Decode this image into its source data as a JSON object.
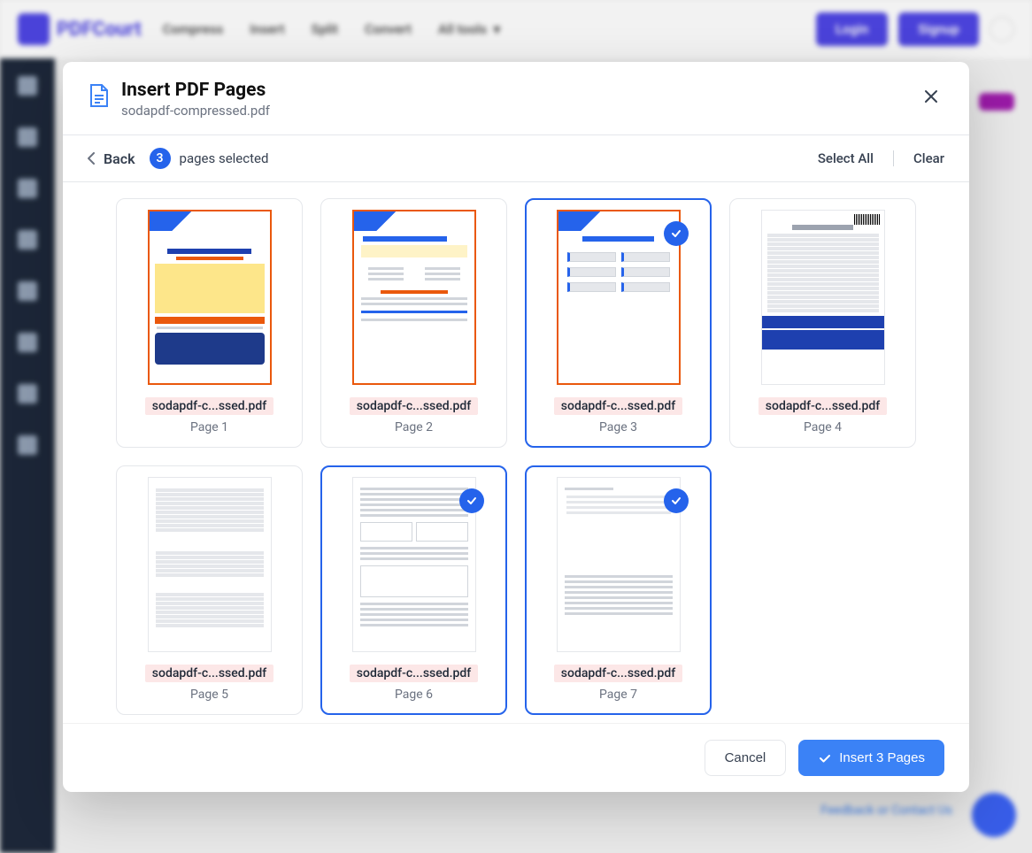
{
  "background": {
    "logo_text": "PDFCourt",
    "nav": [
      "Compress",
      "Insert",
      "Split",
      "Convert",
      "All tools"
    ],
    "login": "Login",
    "signup": "Signup",
    "feedback": "Feedback or Contact Us"
  },
  "modal": {
    "title": "Insert PDF Pages",
    "subtitle": "sodapdf-compressed.pdf",
    "back_label": "Back",
    "selected_count": "3",
    "selected_label": "pages selected",
    "select_all": "Select All",
    "clear": "Clear",
    "cancel": "Cancel",
    "insert": "Insert 3 Pages"
  },
  "pages": [
    {
      "file": "sodapdf-c...ssed.pdf",
      "label": "Page 1",
      "selected": false,
      "style": "cover"
    },
    {
      "file": "sodapdf-c...ssed.pdf",
      "label": "Page 2",
      "selected": false,
      "style": "illustration"
    },
    {
      "file": "sodapdf-c...ssed.pdf",
      "label": "Page 3",
      "selected": true,
      "style": "why"
    },
    {
      "file": "sodapdf-c...ssed.pdf",
      "label": "Page 4",
      "selected": false,
      "style": "doc1"
    },
    {
      "file": "sodapdf-c...ssed.pdf",
      "label": "Page 5",
      "selected": false,
      "style": "doc2"
    },
    {
      "file": "sodapdf-c...ssed.pdf",
      "label": "Page 6",
      "selected": true,
      "style": "doc3"
    },
    {
      "file": "sodapdf-c...ssed.pdf",
      "label": "Page 7",
      "selected": true,
      "style": "doc4"
    }
  ]
}
